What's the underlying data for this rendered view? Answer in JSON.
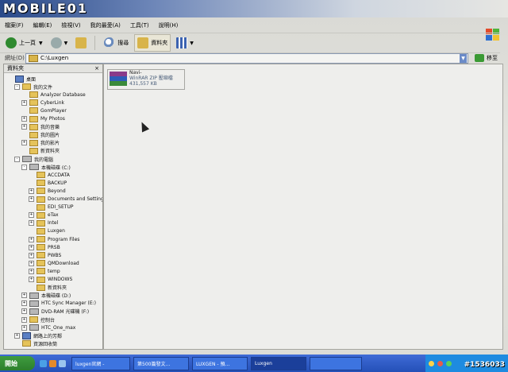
{
  "watermark": {
    "brand": "MOBILE01",
    "tag": "#1536033"
  },
  "menu": [
    "檔案(F)",
    "編輯(E)",
    "檢視(V)",
    "我的最愛(A)",
    "工具(T)",
    "說明(H)"
  ],
  "toolbar": {
    "back": "上一頁",
    "search": "搜尋",
    "folders": "資料夾"
  },
  "address": {
    "label": "網址(D)",
    "value": "C:\\Luxgen",
    "go": "移至"
  },
  "folders_pane": {
    "title": "資料夾",
    "close": "×"
  },
  "tree": [
    {
      "label": "桌面",
      "indent": 0,
      "icon": "desktop",
      "pm": ""
    },
    {
      "label": "我的文件",
      "indent": 1,
      "icon": "folder",
      "pm": "-"
    },
    {
      "label": "Analyzer Database",
      "indent": 2,
      "icon": "folder",
      "pm": ""
    },
    {
      "label": "CyberLink",
      "indent": 2,
      "icon": "folder",
      "pm": "+"
    },
    {
      "label": "GomPlayer",
      "indent": 2,
      "icon": "folder",
      "pm": ""
    },
    {
      "label": "My Photos",
      "indent": 2,
      "icon": "folder",
      "pm": "+"
    },
    {
      "label": "我的音樂",
      "indent": 2,
      "icon": "folder",
      "pm": "+"
    },
    {
      "label": "我的圖片",
      "indent": 2,
      "icon": "folder",
      "pm": ""
    },
    {
      "label": "我的影片",
      "indent": 2,
      "icon": "folder",
      "pm": "+"
    },
    {
      "label": "新資料夾",
      "indent": 2,
      "icon": "folder",
      "pm": ""
    },
    {
      "label": "我的電腦",
      "indent": 1,
      "icon": "drive",
      "pm": "-"
    },
    {
      "label": "本機磁碟 (C:)",
      "indent": 2,
      "icon": "drive",
      "pm": "-"
    },
    {
      "label": "ACCDATA",
      "indent": 3,
      "icon": "folder",
      "pm": ""
    },
    {
      "label": "BACKUP",
      "indent": 3,
      "icon": "folder",
      "pm": ""
    },
    {
      "label": "Beyond",
      "indent": 3,
      "icon": "folder",
      "pm": "+"
    },
    {
      "label": "Documents and Settings",
      "indent": 3,
      "icon": "folder",
      "pm": "+"
    },
    {
      "label": "EDI_SETUP",
      "indent": 3,
      "icon": "folder",
      "pm": ""
    },
    {
      "label": "eTax",
      "indent": 3,
      "icon": "folder",
      "pm": "+"
    },
    {
      "label": "Intel",
      "indent": 3,
      "icon": "folder",
      "pm": "+"
    },
    {
      "label": "Luxgen",
      "indent": 3,
      "icon": "folder",
      "pm": ""
    },
    {
      "label": "Program Files",
      "indent": 3,
      "icon": "folder",
      "pm": "+"
    },
    {
      "label": "PRSB",
      "indent": 3,
      "icon": "folder",
      "pm": "+"
    },
    {
      "label": "PWBS",
      "indent": 3,
      "icon": "folder",
      "pm": "+"
    },
    {
      "label": "QMDownload",
      "indent": 3,
      "icon": "folder",
      "pm": "+"
    },
    {
      "label": "temp",
      "indent": 3,
      "icon": "folder",
      "pm": "+"
    },
    {
      "label": "WINDOWS",
      "indent": 3,
      "icon": "folder",
      "pm": "+"
    },
    {
      "label": "新資料夾",
      "indent": 3,
      "icon": "folder",
      "pm": ""
    },
    {
      "label": "本機磁碟 (D:)",
      "indent": 2,
      "icon": "drive",
      "pm": "+"
    },
    {
      "label": "HTC Sync Manager (E:)",
      "indent": 2,
      "icon": "drive",
      "pm": "+"
    },
    {
      "label": "DVD-RAM 光碟機 (F:)",
      "indent": 2,
      "icon": "drive",
      "pm": "+"
    },
    {
      "label": "控制台",
      "indent": 2,
      "icon": "folder",
      "pm": "+"
    },
    {
      "label": "HTC_One_max",
      "indent": 2,
      "icon": "drive",
      "pm": "+"
    },
    {
      "label": "網路上的芳鄰",
      "indent": 1,
      "icon": "desktop",
      "pm": "+"
    },
    {
      "label": "資源回收筒",
      "indent": 1,
      "icon": "folder",
      "pm": ""
    }
  ],
  "file": {
    "name": "Navi-",
    "type": "WinRAR ZIP 壓縮檔",
    "size": "431,557 KB"
  },
  "taskbar": {
    "start": "開始",
    "tasks": [
      "luxgen官網 -",
      "第500篇發文…",
      "LUXGEN - 預…",
      "Luxgen",
      ""
    ]
  },
  "colors": {
    "accent": "#2450b8",
    "start": "#2d7f2d",
    "folder": "#e5c35a"
  }
}
